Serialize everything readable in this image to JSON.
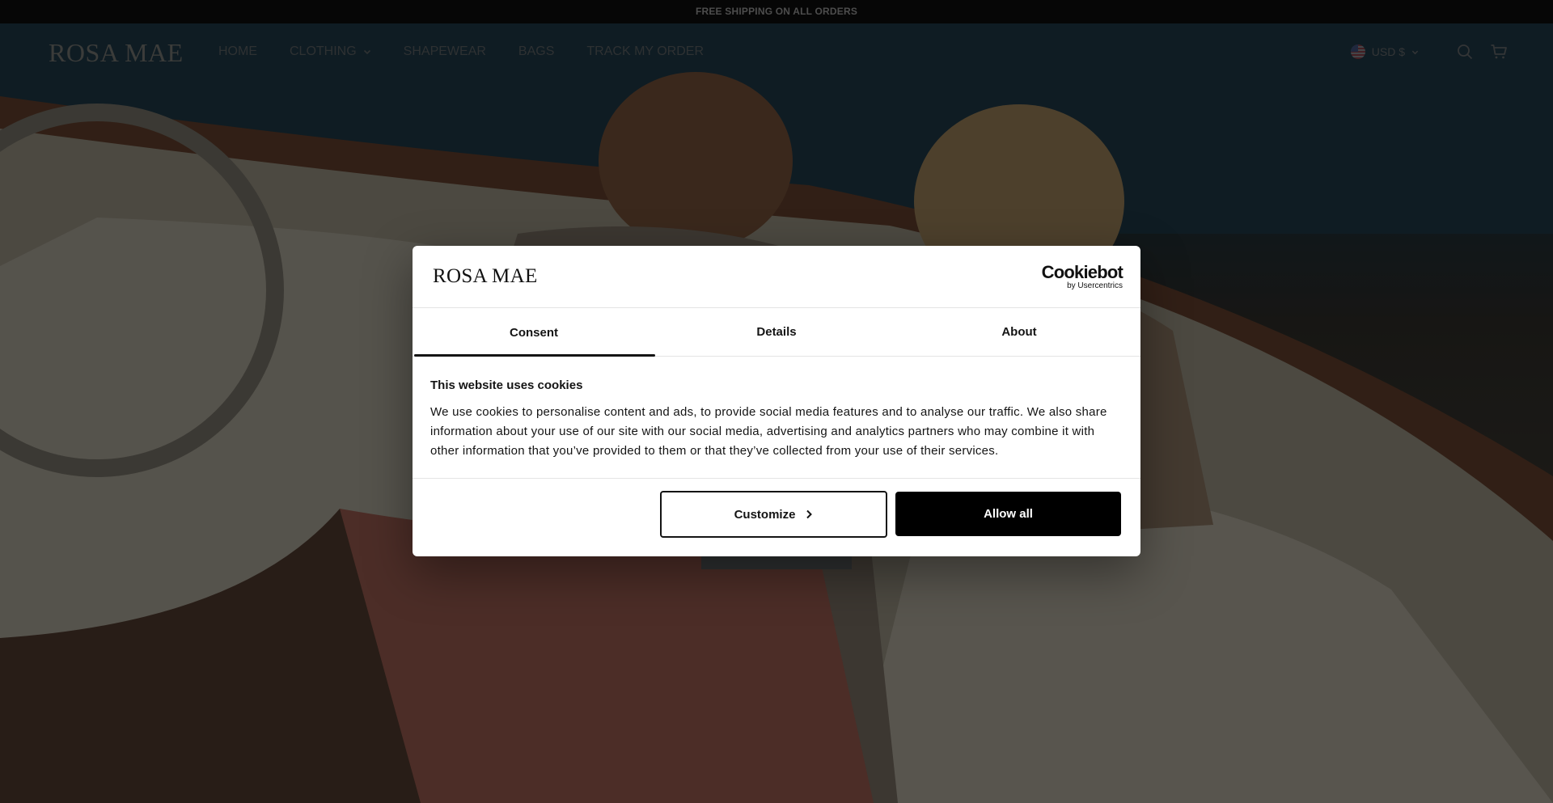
{
  "announcement": "FREE SHIPPING ON ALL ORDERS",
  "header": {
    "logo": "ROSA MAE",
    "nav": [
      {
        "label": "HOME"
      },
      {
        "label": "CLOTHING"
      },
      {
        "label": "SHAPEWEAR"
      },
      {
        "label": "BAGS"
      },
      {
        "label": "TRACK MY ORDER"
      }
    ],
    "currency": "USD $",
    "icons": [
      "search-icon",
      "cart-icon",
      "chevron-down-icon",
      "us-flag-icon"
    ]
  },
  "cookie_dialog": {
    "logo": "ROSA MAE",
    "provider": "Cookiebot",
    "provider_sub": "by Usercentrics",
    "tabs": [
      {
        "label": "Consent",
        "active": true
      },
      {
        "label": "Details",
        "active": false
      },
      {
        "label": "About",
        "active": false
      }
    ],
    "heading": "This website uses cookies",
    "body": "We use cookies to personalise content and ads, to provide social media features and to analyse our traffic. We also share information about your use of our site with our social media, advertising and analytics partners who may combine it with other information that you’ve provided to them or that they’ve collected from your use of their services.",
    "customize_label": "Customize",
    "allow_label": "Allow all"
  },
  "colors": {
    "overlay": "#000000",
    "dialog_bg": "#ffffff",
    "primary_button": "#000000",
    "text": "#141414"
  }
}
